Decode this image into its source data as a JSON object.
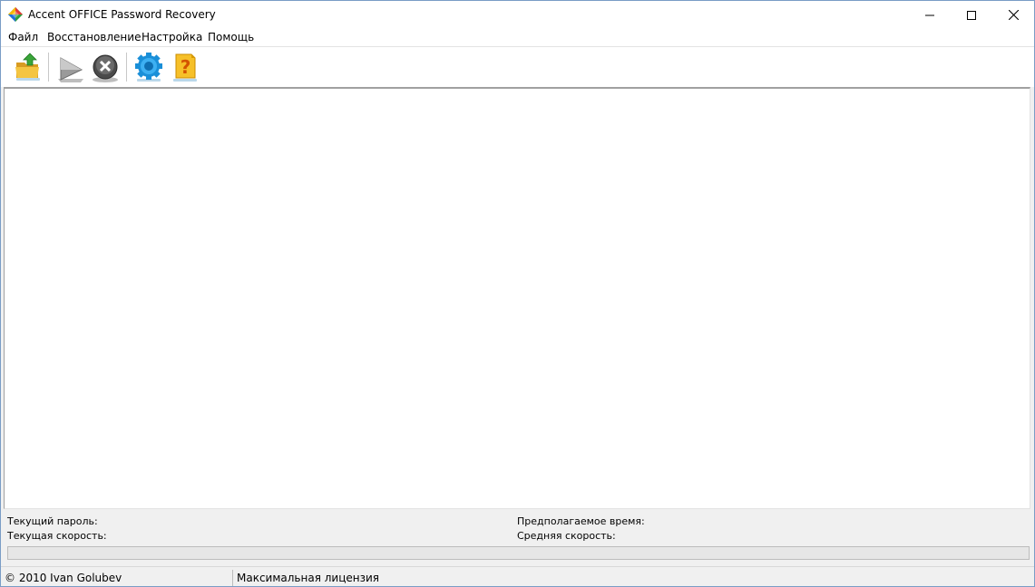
{
  "window": {
    "title": "Accent OFFICE Password Recovery"
  },
  "menu": {
    "items": [
      {
        "label": "Файл"
      },
      {
        "label": "Восстановление"
      },
      {
        "label": "Настройка"
      },
      {
        "label": "Помощь"
      }
    ]
  },
  "toolbar": {
    "buttons": [
      {
        "icon": "open-folder-icon"
      },
      {
        "icon": "play-icon"
      },
      {
        "icon": "stop-icon"
      },
      {
        "icon": "settings-gear-icon"
      },
      {
        "icon": "help-icon"
      }
    ]
  },
  "info": {
    "current_password_label": "Текущий пароль:",
    "current_speed_label": "Текущая скорость:",
    "estimated_time_label": "Предполагаемое время:",
    "average_speed_label": "Средняя скорость:"
  },
  "progress": {
    "value": 0
  },
  "statusbar": {
    "copyright": "© 2010 Ivan Golubev",
    "license": "Максимальная лицензия"
  },
  "colors": {
    "window_border": "#7a9cc6",
    "background": "#f0f0f0",
    "panel": "#ffffff"
  }
}
